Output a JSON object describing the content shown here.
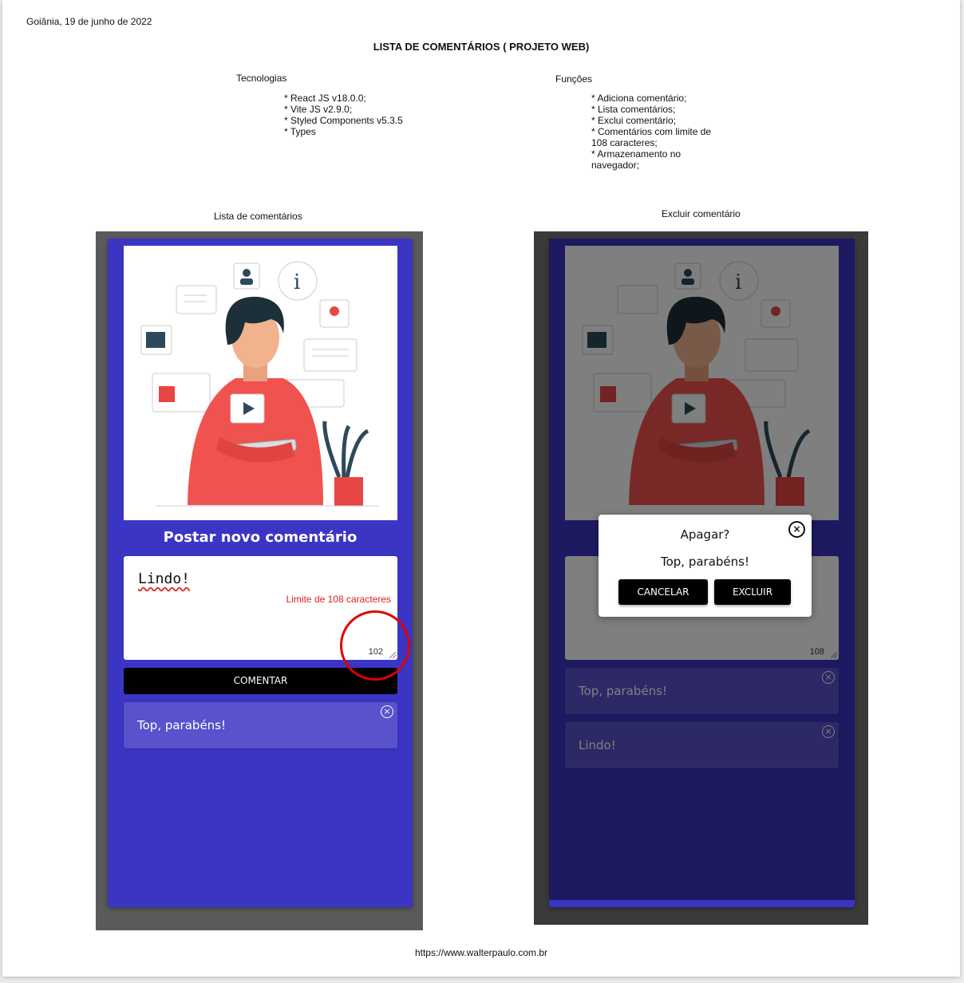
{
  "header": {
    "date": "Goiânia, 19 de junho de 2022",
    "title": "LISTA DE COMENTÁRIOS ( PROJETO WEB)"
  },
  "technologies": {
    "heading": "Tecnologias",
    "items": [
      "* React JS v18.0.0;",
      "* Vite JS v2.9.0;",
      "* Styled Components v5.3.5",
      "* Types"
    ]
  },
  "functions": {
    "heading": "Funções",
    "items": [
      "* Adiciona comentário;",
      "* Lista comentários;",
      "* Exclui comentário;",
      "* Comentários com limite de",
      "108 caracteres;",
      "* Armazenamento no",
      "navegador;"
    ]
  },
  "screen_left": {
    "caption": "Lista de comentários",
    "post_title": "Postar novo comentário",
    "textarea_value": "Lindo!",
    "limit_text": "Limite de 108 caracteres",
    "counter": "102",
    "comment_button": "COMENTAR",
    "comments": [
      "Top, parabéns!"
    ],
    "close_glyph": "×"
  },
  "screen_right": {
    "caption": "Excluir comentário",
    "counter": "108",
    "comments": [
      "Top, parabéns!",
      "Lindo!"
    ],
    "modal": {
      "title": "Apagar?",
      "body": "Top, parabéns!",
      "cancel": "CANCELAR",
      "delete": "EXCLUIR",
      "close_glyph": "×"
    }
  },
  "footer": "https://www.walterpaulo.com.br",
  "colors": {
    "app_bg": "#3b35c4",
    "card_bg": "#5852cc",
    "limit_text": "#e02020",
    "highlight_circle": "#e00000"
  }
}
